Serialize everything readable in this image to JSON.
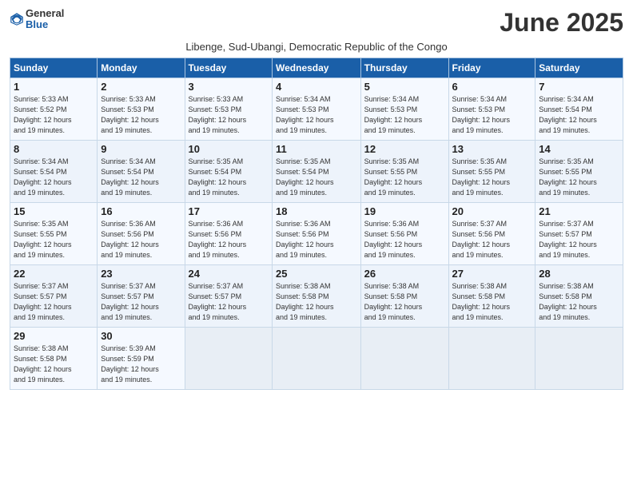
{
  "header": {
    "logo_general": "General",
    "logo_blue": "Blue",
    "month_title": "June 2025",
    "subtitle": "Libenge, Sud-Ubangi, Democratic Republic of the Congo"
  },
  "days_of_week": [
    "Sunday",
    "Monday",
    "Tuesday",
    "Wednesday",
    "Thursday",
    "Friday",
    "Saturday"
  ],
  "weeks": [
    [
      {
        "day": "1",
        "info": "Sunrise: 5:33 AM\nSunset: 5:52 PM\nDaylight: 12 hours\nand 19 minutes."
      },
      {
        "day": "2",
        "info": "Sunrise: 5:33 AM\nSunset: 5:53 PM\nDaylight: 12 hours\nand 19 minutes."
      },
      {
        "day": "3",
        "info": "Sunrise: 5:33 AM\nSunset: 5:53 PM\nDaylight: 12 hours\nand 19 minutes."
      },
      {
        "day": "4",
        "info": "Sunrise: 5:34 AM\nSunset: 5:53 PM\nDaylight: 12 hours\nand 19 minutes."
      },
      {
        "day": "5",
        "info": "Sunrise: 5:34 AM\nSunset: 5:53 PM\nDaylight: 12 hours\nand 19 minutes."
      },
      {
        "day": "6",
        "info": "Sunrise: 5:34 AM\nSunset: 5:53 PM\nDaylight: 12 hours\nand 19 minutes."
      },
      {
        "day": "7",
        "info": "Sunrise: 5:34 AM\nSunset: 5:54 PM\nDaylight: 12 hours\nand 19 minutes."
      }
    ],
    [
      {
        "day": "8",
        "info": "Sunrise: 5:34 AM\nSunset: 5:54 PM\nDaylight: 12 hours\nand 19 minutes."
      },
      {
        "day": "9",
        "info": "Sunrise: 5:34 AM\nSunset: 5:54 PM\nDaylight: 12 hours\nand 19 minutes."
      },
      {
        "day": "10",
        "info": "Sunrise: 5:35 AM\nSunset: 5:54 PM\nDaylight: 12 hours\nand 19 minutes."
      },
      {
        "day": "11",
        "info": "Sunrise: 5:35 AM\nSunset: 5:54 PM\nDaylight: 12 hours\nand 19 minutes."
      },
      {
        "day": "12",
        "info": "Sunrise: 5:35 AM\nSunset: 5:55 PM\nDaylight: 12 hours\nand 19 minutes."
      },
      {
        "day": "13",
        "info": "Sunrise: 5:35 AM\nSunset: 5:55 PM\nDaylight: 12 hours\nand 19 minutes."
      },
      {
        "day": "14",
        "info": "Sunrise: 5:35 AM\nSunset: 5:55 PM\nDaylight: 12 hours\nand 19 minutes."
      }
    ],
    [
      {
        "day": "15",
        "info": "Sunrise: 5:35 AM\nSunset: 5:55 PM\nDaylight: 12 hours\nand 19 minutes."
      },
      {
        "day": "16",
        "info": "Sunrise: 5:36 AM\nSunset: 5:56 PM\nDaylight: 12 hours\nand 19 minutes."
      },
      {
        "day": "17",
        "info": "Sunrise: 5:36 AM\nSunset: 5:56 PM\nDaylight: 12 hours\nand 19 minutes."
      },
      {
        "day": "18",
        "info": "Sunrise: 5:36 AM\nSunset: 5:56 PM\nDaylight: 12 hours\nand 19 minutes."
      },
      {
        "day": "19",
        "info": "Sunrise: 5:36 AM\nSunset: 5:56 PM\nDaylight: 12 hours\nand 19 minutes."
      },
      {
        "day": "20",
        "info": "Sunrise: 5:37 AM\nSunset: 5:56 PM\nDaylight: 12 hours\nand 19 minutes."
      },
      {
        "day": "21",
        "info": "Sunrise: 5:37 AM\nSunset: 5:57 PM\nDaylight: 12 hours\nand 19 minutes."
      }
    ],
    [
      {
        "day": "22",
        "info": "Sunrise: 5:37 AM\nSunset: 5:57 PM\nDaylight: 12 hours\nand 19 minutes."
      },
      {
        "day": "23",
        "info": "Sunrise: 5:37 AM\nSunset: 5:57 PM\nDaylight: 12 hours\nand 19 minutes."
      },
      {
        "day": "24",
        "info": "Sunrise: 5:37 AM\nSunset: 5:57 PM\nDaylight: 12 hours\nand 19 minutes."
      },
      {
        "day": "25",
        "info": "Sunrise: 5:38 AM\nSunset: 5:58 PM\nDaylight: 12 hours\nand 19 minutes."
      },
      {
        "day": "26",
        "info": "Sunrise: 5:38 AM\nSunset: 5:58 PM\nDaylight: 12 hours\nand 19 minutes."
      },
      {
        "day": "27",
        "info": "Sunrise: 5:38 AM\nSunset: 5:58 PM\nDaylight: 12 hours\nand 19 minutes."
      },
      {
        "day": "28",
        "info": "Sunrise: 5:38 AM\nSunset: 5:58 PM\nDaylight: 12 hours\nand 19 minutes."
      }
    ],
    [
      {
        "day": "29",
        "info": "Sunrise: 5:38 AM\nSunset: 5:58 PM\nDaylight: 12 hours\nand 19 minutes."
      },
      {
        "day": "30",
        "info": "Sunrise: 5:39 AM\nSunset: 5:59 PM\nDaylight: 12 hours\nand 19 minutes."
      },
      {
        "day": "",
        "info": ""
      },
      {
        "day": "",
        "info": ""
      },
      {
        "day": "",
        "info": ""
      },
      {
        "day": "",
        "info": ""
      },
      {
        "day": "",
        "info": ""
      }
    ]
  ]
}
